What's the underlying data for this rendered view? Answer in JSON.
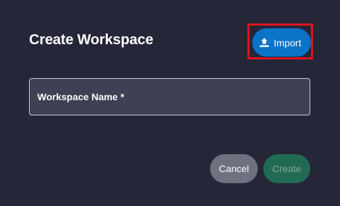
{
  "dialog": {
    "title": "Create Workspace"
  },
  "import": {
    "label": "Import",
    "icon": "upload-icon",
    "highlight_color": "#e0141e",
    "button_color": "#0a74c8"
  },
  "workspace_name": {
    "label": "Workspace Name *",
    "value": ""
  },
  "actions": {
    "cancel_label": "Cancel",
    "create_label": "Create",
    "create_disabled": true
  }
}
